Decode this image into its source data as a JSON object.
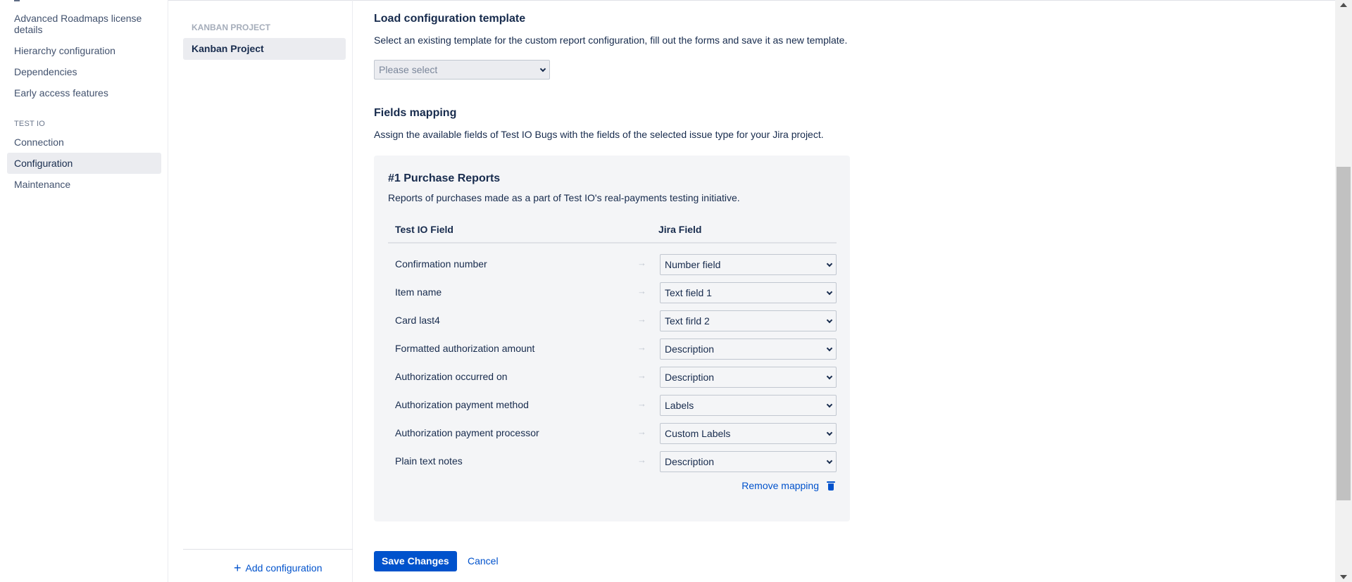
{
  "sidebar": {
    "items_top": [
      {
        "label": "Advanced Roadmaps license details"
      },
      {
        "label": "Hierarchy configuration"
      },
      {
        "label": "Dependencies"
      },
      {
        "label": "Early access features"
      }
    ],
    "section_heading": "TEST IO",
    "items_section": [
      {
        "label": "Connection"
      },
      {
        "label": "Configuration",
        "active": true
      },
      {
        "label": "Maintenance"
      }
    ]
  },
  "projects": {
    "heading": "KANBAN PROJECT",
    "selected": "Kanban Project",
    "add_configuration": "Add configuration"
  },
  "template": {
    "title": "Load configuration template",
    "description": "Select an existing template for the custom report configuration, fill out the forms and save it as new template.",
    "select_placeholder": "Please select"
  },
  "mapping": {
    "title": "Fields mapping",
    "description": "Assign the available fields of Test IO Bugs with the fields of the selected issue type for your Jira project.",
    "card": {
      "title": "#1 Purchase Reports",
      "description": "Reports of purchases made as a part of Test IO's real-payments testing initiative.",
      "col_testio": "Test IO Field",
      "col_jira": "Jira Field",
      "rows": [
        {
          "testio": "Confirmation number",
          "jira": "Number field"
        },
        {
          "testio": "Item name",
          "jira": "Text field 1"
        },
        {
          "testio": "Card last4",
          "jira": "Text firld 2"
        },
        {
          "testio": "Formatted authorization amount",
          "jira": "Description"
        },
        {
          "testio": "Authorization occurred on",
          "jira": "Description"
        },
        {
          "testio": "Authorization payment method",
          "jira": "Labels"
        },
        {
          "testio": "Authorization payment processor",
          "jira": "Custom Labels"
        },
        {
          "testio": "Plain text notes",
          "jira": "Description"
        }
      ],
      "remove_label": "Remove mapping"
    }
  },
  "actions": {
    "save": "Save Changes",
    "cancel": "Cancel"
  },
  "colors": {
    "primary": "#0052cc",
    "text": "#172b4d",
    "card_bg": "#f4f5f7"
  }
}
